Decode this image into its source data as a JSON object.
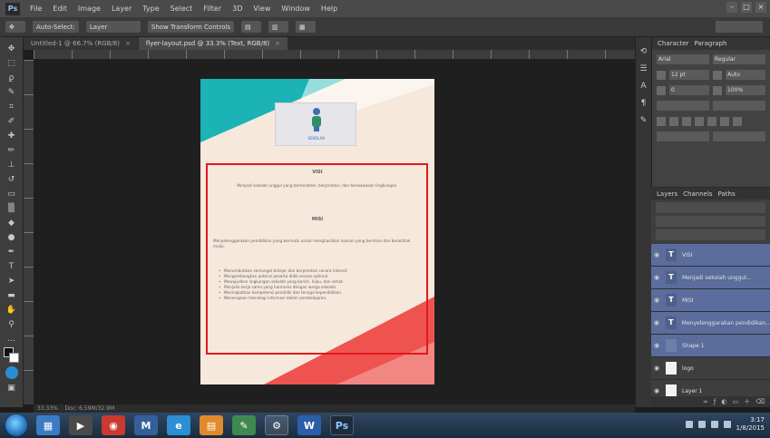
{
  "app": {
    "logo": "Ps",
    "menus": [
      "File",
      "Edit",
      "Image",
      "Layer",
      "Type",
      "Select",
      "Filter",
      "3D",
      "View",
      "Window",
      "Help"
    ]
  },
  "options_bar": {
    "items": [
      "Auto-Select:",
      "Layer",
      "Show Transform Controls"
    ]
  },
  "tabs": [
    {
      "label": "Untitled-1 @ 66.7% (RGB/8)"
    },
    {
      "label": "flyer-layout.psd @ 33.3% (Text, RGB/8)"
    }
  ],
  "tools": [
    "move",
    "marquee",
    "lasso",
    "quick-select",
    "crop",
    "eyedropper",
    "healing",
    "brush",
    "stamp",
    "history-brush",
    "eraser",
    "gradient",
    "blur",
    "dodge",
    "pen",
    "type",
    "path-select",
    "shape",
    "hand",
    "zoom"
  ],
  "document": {
    "logo_text": "SEKOLAH",
    "heading1": "VISI",
    "para1": "Menjadi sekolah unggul yang berkarakter, berprestasi, dan berwawasan lingkungan.",
    "heading2": "MISI",
    "para2": "Menyelenggarakan pendidikan yang bermutu untuk menghasilkan lulusan yang beriman dan berakhlak mulia.",
    "bullets": [
      "Menumbuhkan semangat belajar dan berprestasi secara intensif.",
      "Mengembangkan potensi peserta didik secara optimal.",
      "Mewujudkan lingkungan sekolah yang bersih, hijau, dan sehat.",
      "Menjalin kerja sama yang harmonis dengan warga sekolah.",
      "Meningkatkan kompetensi pendidik dan tenaga kependidikan.",
      "Menerapkan teknologi informasi dalam pembelajaran."
    ],
    "colors": {
      "teal": "#1bb3b5",
      "coral": "#ef5350",
      "paper": "#f6e9dc",
      "selection": "#e0191f"
    }
  },
  "status": {
    "zoom": "33.33%",
    "doc_size": "Doc: 6.59M/32.9M"
  },
  "panels": {
    "tabs": [
      "Character",
      "Paragraph"
    ],
    "fields": [
      "Arial",
      "Regular",
      "12 pt",
      "Auto",
      "0",
      "100%"
    ]
  },
  "layers": {
    "tabs": [
      "Layers",
      "Channels",
      "Paths"
    ],
    "items": [
      {
        "name": "VISI",
        "type": "text",
        "selected": true
      },
      {
        "name": "Menjadi sekolah unggul...",
        "type": "text",
        "selected": true
      },
      {
        "name": "MISI",
        "type": "text",
        "selected": true
      },
      {
        "name": "Menyelenggarakan pendidikan...",
        "type": "text",
        "selected": true
      },
      {
        "name": "Shape 1",
        "type": "shape",
        "selected": true
      },
      {
        "name": "logo",
        "type": "image",
        "selected": false
      },
      {
        "name": "Layer 1",
        "type": "image",
        "selected": false
      }
    ]
  },
  "taskbar": {
    "icons": [
      "explorer",
      "media",
      "chrome",
      "mail",
      "ie",
      "folder",
      "paint",
      "network",
      "word",
      "photoshop"
    ],
    "clock_time": "3:17",
    "clock_date": "1/8/2015"
  }
}
